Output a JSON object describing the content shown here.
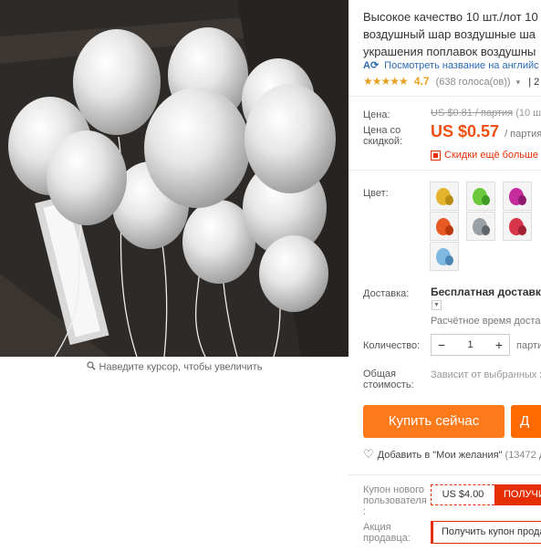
{
  "product_image": {
    "alt": "white pearl latex balloons",
    "zoom_hint": "Наведите курсор, чтобы увеличить",
    "zoom_icon": "magnifier-icon"
  },
  "product": {
    "title_lines": [
      "Высокое качество 10 шт./лот 10",
      "воздушный шар воздушные ша",
      "украшения поплавок воздушны"
    ],
    "translate_icon": "translate-icon",
    "translate_link": "Посмотреть название на английс",
    "stars": "★★★★★",
    "rating": "4.7",
    "votes": "(638 голоса(ов))",
    "rating_extra": "2"
  },
  "pricing": {
    "price_label": "Цена:",
    "old_price": "US $0.81",
    "old_price_unit": "/ партия",
    "old_price_extra": "(10 шт",
    "discount_price_label": "Цена со скидкой:",
    "new_price": "US $0.57",
    "new_price_unit": "/ партия",
    "discounts_link": "Скидки ещё больше в"
  },
  "options": {
    "color_label": "Цвет:",
    "colors": [
      {
        "name": "gold",
        "hex": "#e3b52e"
      },
      {
        "name": "green",
        "hex": "#6cc93e"
      },
      {
        "name": "purple",
        "hex": "#c62c9e"
      },
      {
        "name": "orange",
        "hex": "#e85a24"
      },
      {
        "name": "silver",
        "hex": "#9aa0a6"
      },
      {
        "name": "red",
        "hex": "#d8354a"
      },
      {
        "name": "light-blue",
        "hex": "#7fb7e0"
      }
    ]
  },
  "shipping": {
    "label": "Доставка:",
    "delivery": "Бесплатная доставка в",
    "estimate": "Расчётное время достав"
  },
  "quantity": {
    "label": "Количество:",
    "minus": "−",
    "value": "1",
    "plus": "+",
    "unit": "парти"
  },
  "total": {
    "label_line1": "Общая",
    "label_line2": "стоимость:",
    "value": "Зависит от выбранных х"
  },
  "actions": {
    "buy_now": "Купить сейчас",
    "add_to_cart": "Д",
    "wishlist": "Добавить в \"Мои желания\"",
    "wishlist_count": "(13472 д"
  },
  "coupons": {
    "new_user_label_lines": [
      "Купон нового",
      "пользователя",
      ":"
    ],
    "new_user_value": "US $4.00",
    "new_user_button": "ПОЛУЧИ",
    "seller_label_lines": [
      "Акция",
      "продавца:"
    ],
    "seller_button": "Получить купон продав"
  },
  "colors": {
    "accent_orange": "#ff7a1a",
    "price_red": "#f04e12",
    "link_blue": "#2a6ab5",
    "star_yellow": "#e8a020"
  }
}
